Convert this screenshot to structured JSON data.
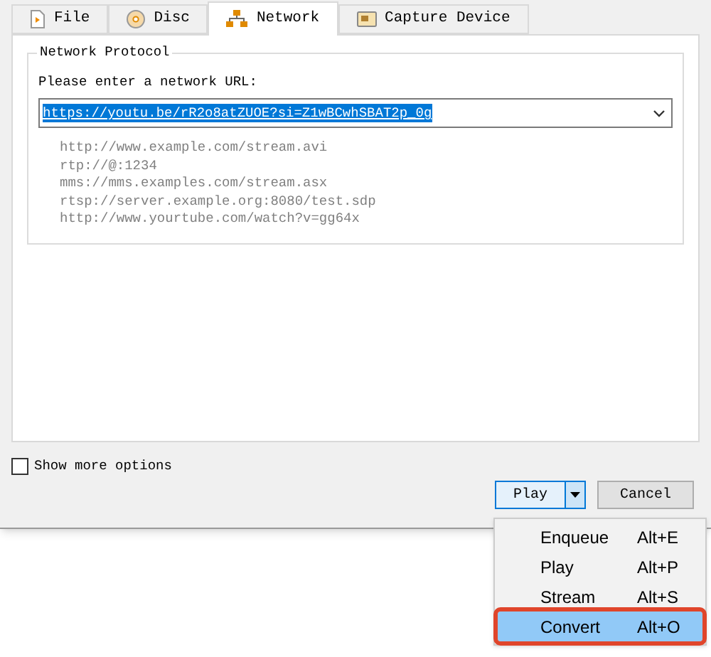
{
  "tabs": [
    {
      "label": "File",
      "kind": "file",
      "selected": false
    },
    {
      "label": "Disc",
      "kind": "disc",
      "selected": false
    },
    {
      "label": "Network",
      "kind": "network",
      "selected": true
    },
    {
      "label": "Capture Device",
      "kind": "capture",
      "selected": false
    }
  ],
  "group": {
    "title": "Network Protocol",
    "label": "Please enter a network URL:",
    "url": "https://youtu.be/rR2o8atZUOE?si=Z1wBCwhSBAT2p_0g",
    "examples": [
      "http://www.example.com/stream.avi",
      "rtp://@:1234",
      "mms://mms.examples.com/stream.asx",
      "rtsp://server.example.org:8080/test.sdp",
      "http://www.yourtube.com/watch?v=gg64x"
    ]
  },
  "show_more_options": {
    "label": "Show more options",
    "checked": false
  },
  "buttons": {
    "play": "Play",
    "cancel": "Cancel"
  },
  "menu": [
    {
      "label": "Enqueue",
      "shortcut": "Alt+E",
      "selected": false
    },
    {
      "label": "Play",
      "shortcut": "Alt+P",
      "selected": false
    },
    {
      "label": "Stream",
      "shortcut": "Alt+S",
      "selected": false
    },
    {
      "label": "Convert",
      "shortcut": "Alt+O",
      "selected": true
    }
  ]
}
